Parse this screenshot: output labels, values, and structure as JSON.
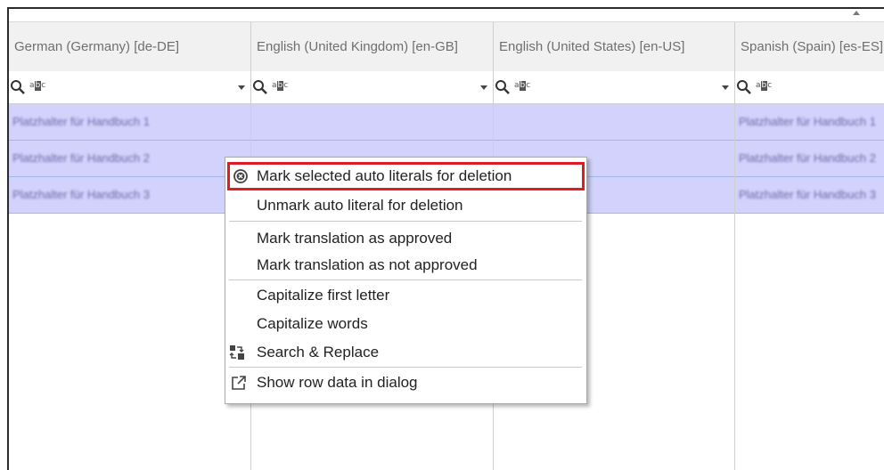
{
  "grid": {
    "columns": [
      {
        "label": "German (Germany) [de-DE]"
      },
      {
        "label": "English (United Kingdom) [en-GB]"
      },
      {
        "label": "English (United States) [en-US]"
      },
      {
        "label": "Spanish (Spain) [es-ES]"
      }
    ],
    "rows": [
      {
        "cells": [
          "Platzhalter für Handbuch 1",
          "",
          "",
          "Platzhalter für Handbuch 1"
        ]
      },
      {
        "cells": [
          "Platzhalter für Handbuch 2",
          "",
          "",
          "Platzhalter für Handbuch 2"
        ]
      },
      {
        "cells": [
          "Platzhalter für Handbuch 3",
          "",
          "",
          "Platzhalter für Handbuch 3"
        ]
      }
    ],
    "filter_abc_prefix": "a",
    "filter_abc_mid": "b",
    "filter_abc_suffix": "c"
  },
  "context_menu": {
    "items": [
      {
        "label": "Mark selected auto literals for deletion",
        "icon": "delete-circle-icon",
        "highlighted": true
      },
      {
        "label": "Unmark auto literal for deletion"
      },
      {
        "label": "Mark translation as approved"
      },
      {
        "label": "Mark translation as not approved"
      },
      {
        "label": "Capitalize first letter"
      },
      {
        "label": "Capitalize words"
      },
      {
        "label": "Search & Replace",
        "icon": "search-replace-icon"
      },
      {
        "label": "Show row data in dialog",
        "icon": "external-link-icon"
      }
    ]
  },
  "colors": {
    "selected_row": "#d3d2fc",
    "highlight_border": "#e01b24",
    "header_bg": "#f1f1f1"
  }
}
